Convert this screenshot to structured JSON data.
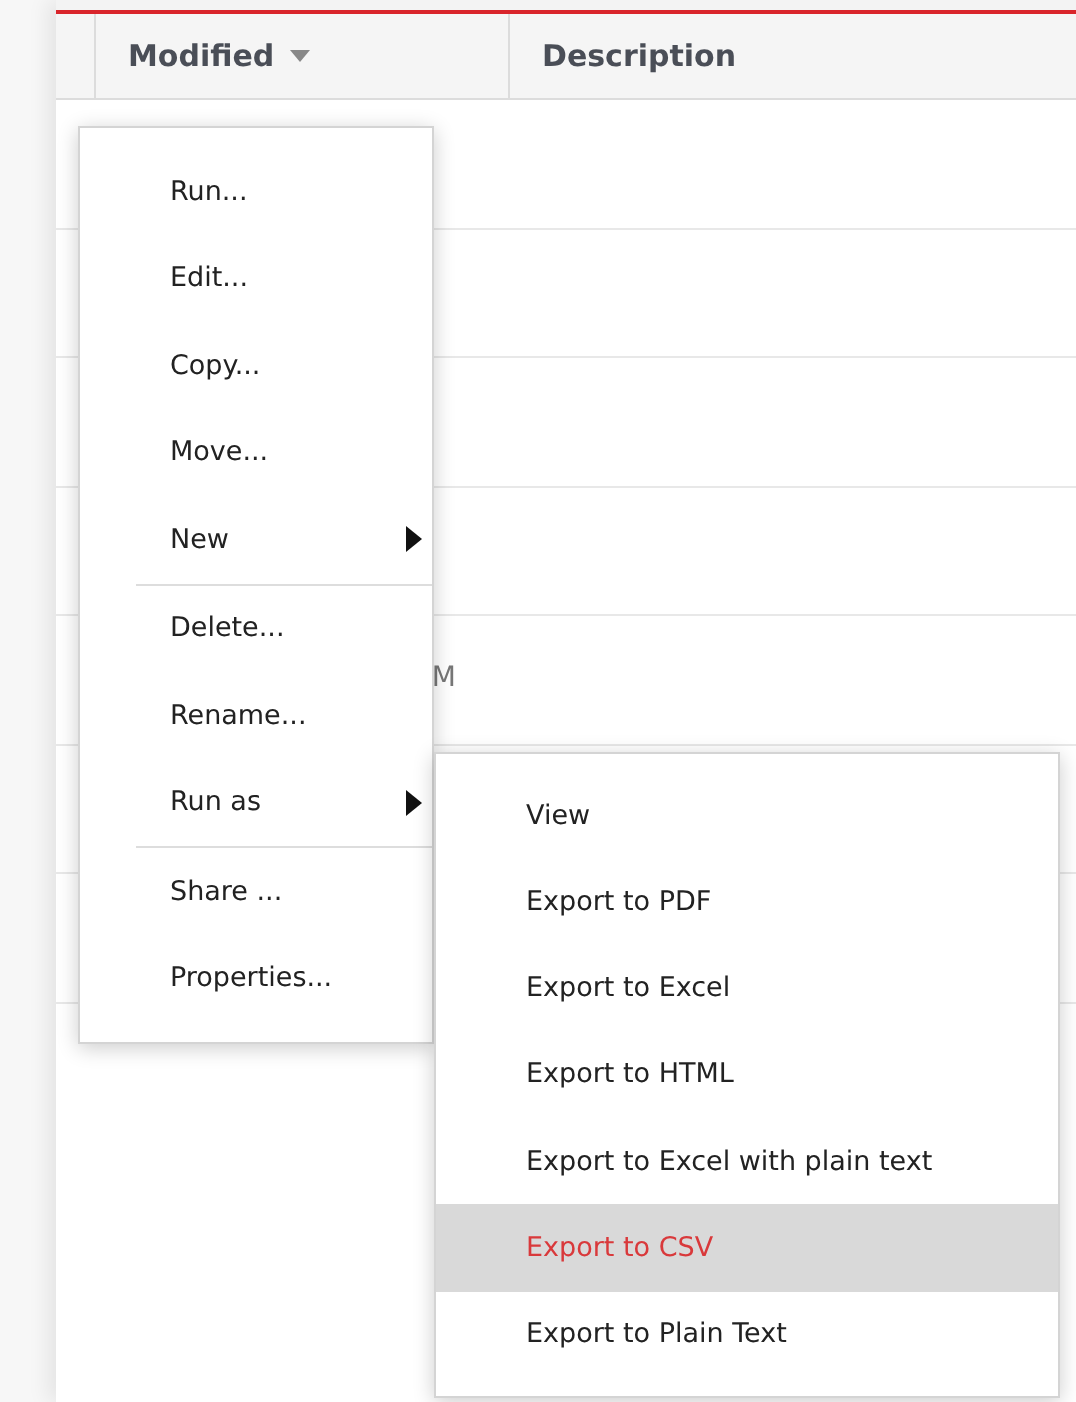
{
  "table": {
    "columns": [
      {
        "label": "Modified",
        "sorted": true
      },
      {
        "label": "Description",
        "sorted": false
      }
    ],
    "rows": [
      {},
      {},
      {},
      {},
      {
        "modified": "M"
      },
      {},
      {}
    ]
  },
  "context_menu": {
    "items": [
      {
        "label": "Run...",
        "submenu": false,
        "divider_before": false
      },
      {
        "label": "Edit...",
        "submenu": false,
        "divider_before": false
      },
      {
        "label": "Copy...",
        "submenu": false,
        "divider_before": false
      },
      {
        "label": "Move...",
        "submenu": false,
        "divider_before": false
      },
      {
        "label": "New",
        "submenu": true,
        "divider_before": false
      },
      {
        "label": "Delete...",
        "submenu": false,
        "divider_before": true
      },
      {
        "label": "Rename...",
        "submenu": false,
        "divider_before": false
      },
      {
        "label": "Run as",
        "submenu": true,
        "divider_before": false
      },
      {
        "label": "Share ...",
        "submenu": false,
        "divider_before": true
      },
      {
        "label": "Properties...",
        "submenu": false,
        "divider_before": false
      }
    ]
  },
  "submenu": {
    "items": [
      {
        "label": "View",
        "selected": false
      },
      {
        "label": "Export to PDF",
        "selected": false
      },
      {
        "label": "Export to Excel",
        "selected": false
      },
      {
        "label": "Export to HTML",
        "selected": false
      },
      {
        "label": "Export to Excel with plain text",
        "selected": false
      },
      {
        "label": "Export to CSV",
        "selected": true
      },
      {
        "label": "Export to Plain Text",
        "selected": false
      }
    ]
  }
}
